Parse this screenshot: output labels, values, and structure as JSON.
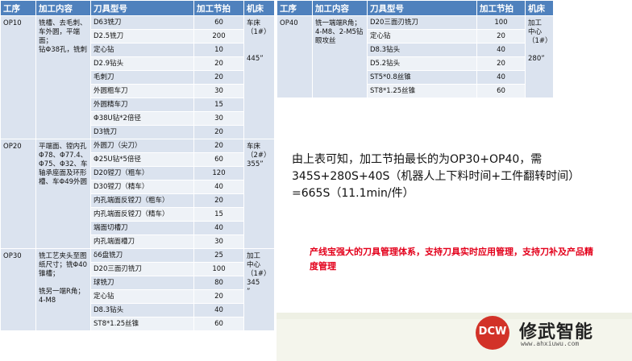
{
  "headers": {
    "op": "工序",
    "content": "加工内容",
    "tool": "刀具型号",
    "beat": "加工节拍",
    "machine": "机床"
  },
  "left_table": [
    {
      "op": "OP10",
      "content": "铣槽、去毛刺、车外圆，平端面；\n钻Φ38孔，铣刺",
      "machine": "车床\n（1#）\n\n\n445”",
      "rows": [
        {
          "tool": "D63铣刀",
          "beat": "60"
        },
        {
          "tool": "D2.5铣刀",
          "beat": "200"
        },
        {
          "tool": "定心钻",
          "beat": "10"
        },
        {
          "tool": "D2.9钻头",
          "beat": "20"
        },
        {
          "tool": "毛刺刀",
          "beat": "20"
        },
        {
          "tool": "外圆粗车刀",
          "beat": "30"
        },
        {
          "tool": "外圆精车刀",
          "beat": "15"
        },
        {
          "tool": "Φ38U钻*2倍径",
          "beat": "30"
        },
        {
          "tool": "D3铣刀",
          "beat": "20"
        }
      ]
    },
    {
      "op": "OP20",
      "content": "平端面、镗内孔Φ78、Φ77.4、Φ75、Φ32、车轴承座面及环形槽、车Φ49外圆",
      "machine": "车床\n（2#）\n355”",
      "rows": [
        {
          "tool": "外圆刀（尖刀）",
          "beat": "20"
        },
        {
          "tool": "Φ25U钻*5倍径",
          "beat": "60"
        },
        {
          "tool": "D20镗刀（粗车）",
          "beat": "120"
        },
        {
          "tool": "D30镗刀（精车）",
          "beat": "40"
        },
        {
          "tool": "内孔端面反镗刀（粗车）",
          "beat": "20"
        },
        {
          "tool": "内孔端面反镗刀（精车）",
          "beat": "15"
        },
        {
          "tool": "端面切槽刀",
          "beat": "40"
        },
        {
          "tool": "内孔端面槽刀",
          "beat": "30"
        }
      ]
    },
    {
      "op": "OP30",
      "content": "铣工艺夹头至图纸尺寸；铣Φ40锥槽；\n\n铣另一端R角；\n  4-M8",
      "machine": "加工\n中心\n（1#）\n345\n”",
      "rows": [
        {
          "tool": "δ6盘铣刀",
          "beat": "25"
        },
        {
          "tool": "D20三面刃铣刀",
          "beat": "100"
        },
        {
          "tool": "球铣刀",
          "beat": "80"
        },
        {
          "tool": "定心钻",
          "beat": "20"
        },
        {
          "tool": "D8.3钻头",
          "beat": "40"
        },
        {
          "tool": "ST8*1.25丝锥",
          "beat": "60"
        }
      ]
    }
  ],
  "right_table": [
    {
      "op": "OP40",
      "content": "铣一端端R角；\n  4-M8、2-M5钻眼攻丝",
      "machine": "加工\n中心\n（1#）\n\n280”",
      "rows": [
        {
          "tool": "D20三面刃铣刀",
          "beat": "100"
        },
        {
          "tool": "定心钻",
          "beat": "20"
        },
        {
          "tool": "D8.3钻头",
          "beat": "40"
        },
        {
          "tool": "D5.2钻头",
          "beat": "20"
        },
        {
          "tool": "ST5*0.8丝锥",
          "beat": "40"
        },
        {
          "tool": "ST8*1.25丝锥",
          "beat": "60"
        }
      ]
    }
  ],
  "summary": "由上表可知，加工节拍最长的为OP30+OP40，需345S+280S+40S（机器人上下料时间+工件翻转时间）=665S（11.1min/件）",
  "highlight": "产线宝强大的刀具管理体系，支持刀具实时应用管理，支持刀补及产品精度管理",
  "logo": {
    "mark": "DCW",
    "name": "修武智能",
    "url": "www.ahxiuwu.com"
  },
  "colors": {
    "header": "#4f81bd",
    "row_a": "#dbe3ef",
    "row_b": "#eef2f7",
    "highlight": "#e3001b",
    "logo": "#d23228"
  }
}
